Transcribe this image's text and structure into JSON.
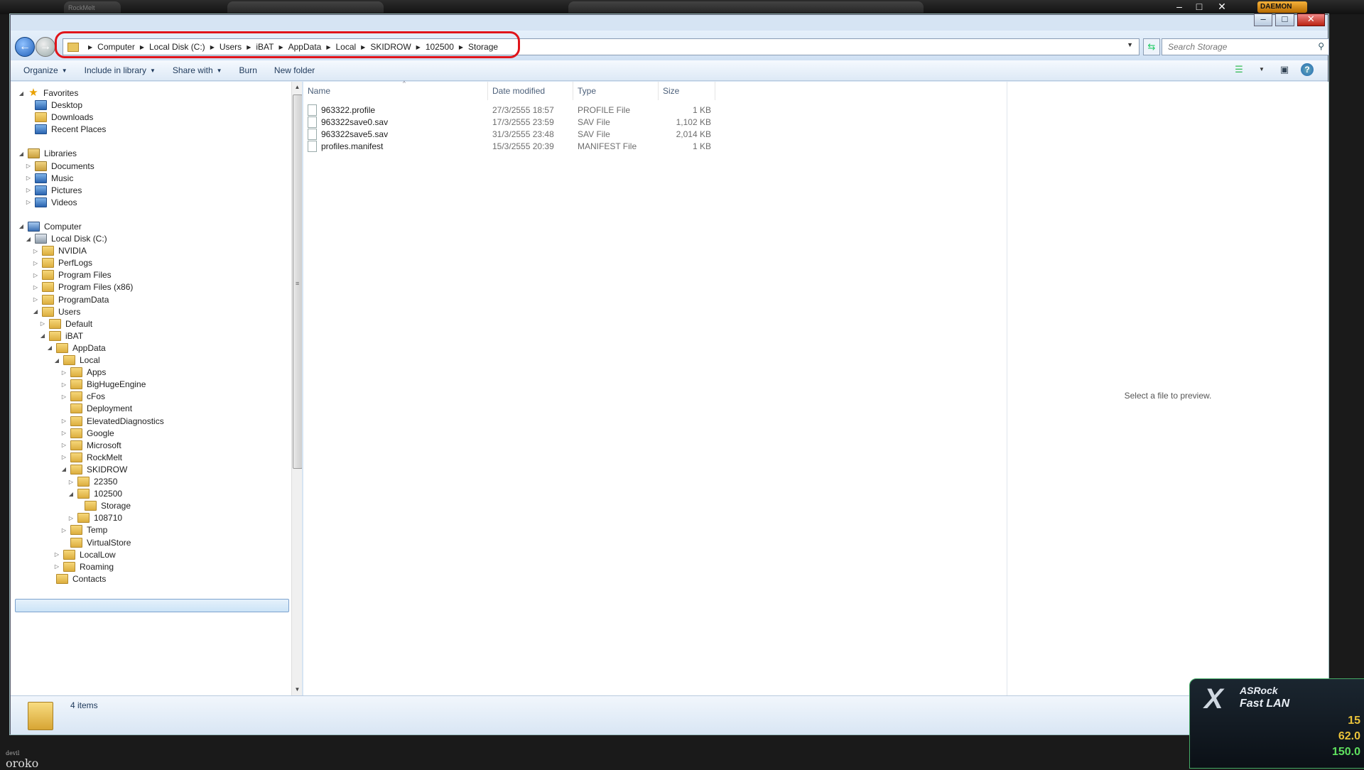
{
  "outer": {
    "taskbar_tab": "RockMelt",
    "daemon_label": "DAEMON",
    "corner_text": "oroko",
    "corner_text_small": "devil"
  },
  "window": {
    "title": "Storage",
    "breadcrumb": [
      "Computer",
      "Local Disk (C:)",
      "Users",
      "iBAT",
      "AppData",
      "Local",
      "SKIDROW",
      "102500",
      "Storage"
    ],
    "search_placeholder": "Search Storage"
  },
  "toolbar": {
    "organize": "Organize",
    "include_in_library": "Include in library",
    "share_with": "Share with",
    "burn": "Burn",
    "new_folder": "New folder"
  },
  "nav": [
    {
      "label": "Favorites",
      "level": 0,
      "icon": "star-icon",
      "expander": "expanded",
      "type": "star"
    },
    {
      "label": "Desktop",
      "level": 1,
      "icon": "desktop-icon",
      "expander": "none",
      "type": "blue"
    },
    {
      "label": "Downloads",
      "level": 1,
      "icon": "downloads-folder-icon",
      "expander": "none",
      "type": "folder"
    },
    {
      "label": "Recent Places",
      "level": 1,
      "icon": "recent-places-icon",
      "expander": "none",
      "type": "blue"
    },
    {
      "label": "",
      "level": 0,
      "icon": "",
      "expander": "none",
      "type": "spacer"
    },
    {
      "label": "Libraries",
      "level": 0,
      "icon": "libraries-icon",
      "expander": "expanded",
      "type": "lib"
    },
    {
      "label": "Documents",
      "level": 1,
      "icon": "documents-icon",
      "expander": "collapsed",
      "type": "lib"
    },
    {
      "label": "Music",
      "level": 1,
      "icon": "music-icon",
      "expander": "collapsed",
      "type": "blue"
    },
    {
      "label": "Pictures",
      "level": 1,
      "icon": "pictures-icon",
      "expander": "collapsed",
      "type": "blue"
    },
    {
      "label": "Videos",
      "level": 1,
      "icon": "videos-icon",
      "expander": "collapsed",
      "type": "blue"
    },
    {
      "label": "",
      "level": 0,
      "icon": "",
      "expander": "none",
      "type": "spacer"
    },
    {
      "label": "Computer",
      "level": 0,
      "icon": "computer-icon",
      "expander": "expanded",
      "type": "pc"
    },
    {
      "label": "Local Disk (C:)",
      "level": 1,
      "icon": "disk-icon",
      "expander": "expanded",
      "type": "disk"
    },
    {
      "label": "NVIDIA",
      "level": 2,
      "icon": "folder-icon",
      "expander": "collapsed",
      "type": "folder"
    },
    {
      "label": "PerfLogs",
      "level": 2,
      "icon": "folder-icon",
      "expander": "collapsed",
      "type": "folder"
    },
    {
      "label": "Program Files",
      "level": 2,
      "icon": "folder-icon",
      "expander": "collapsed",
      "type": "folder"
    },
    {
      "label": "Program Files (x86)",
      "level": 2,
      "icon": "folder-icon",
      "expander": "collapsed",
      "type": "folder"
    },
    {
      "label": "ProgramData",
      "level": 2,
      "icon": "folder-icon",
      "expander": "collapsed",
      "type": "folder"
    },
    {
      "label": "Users",
      "level": 2,
      "icon": "folder-icon",
      "expander": "expanded",
      "type": "folder"
    },
    {
      "label": "Default",
      "level": 3,
      "icon": "folder-icon",
      "expander": "collapsed",
      "type": "folder"
    },
    {
      "label": "iBAT",
      "level": 3,
      "icon": "user-folder-icon",
      "expander": "expanded",
      "type": "folder"
    },
    {
      "label": "AppData",
      "level": 4,
      "icon": "folder-icon",
      "expander": "expanded",
      "type": "folder"
    },
    {
      "label": "Local",
      "level": 5,
      "icon": "folder-icon",
      "expander": "expanded",
      "type": "folder"
    },
    {
      "label": "Apps",
      "level": 6,
      "icon": "folder-icon",
      "expander": "collapsed",
      "type": "folder"
    },
    {
      "label": "BigHugeEngine",
      "level": 6,
      "icon": "folder-icon",
      "expander": "collapsed",
      "type": "folder"
    },
    {
      "label": "cFos",
      "level": 6,
      "icon": "folder-icon",
      "expander": "collapsed",
      "type": "folder"
    },
    {
      "label": "Deployment",
      "level": 6,
      "icon": "folder-icon",
      "expander": "none",
      "type": "folder"
    },
    {
      "label": "ElevatedDiagnostics",
      "level": 6,
      "icon": "folder-icon",
      "expander": "collapsed",
      "type": "folder"
    },
    {
      "label": "Google",
      "level": 6,
      "icon": "folder-icon",
      "expander": "collapsed",
      "type": "folder"
    },
    {
      "label": "Microsoft",
      "level": 6,
      "icon": "folder-icon",
      "expander": "collapsed",
      "type": "folder"
    },
    {
      "label": "RockMelt",
      "level": 6,
      "icon": "folder-icon",
      "expander": "collapsed",
      "type": "folder"
    },
    {
      "label": "SKIDROW",
      "level": 6,
      "icon": "folder-icon",
      "expander": "expanded",
      "type": "folder"
    },
    {
      "label": "22350",
      "level": 7,
      "icon": "folder-icon",
      "expander": "collapsed",
      "type": "folder"
    },
    {
      "label": "102500",
      "level": 7,
      "icon": "folder-icon",
      "expander": "expanded",
      "type": "folder"
    },
    {
      "label": "Storage",
      "level": 8,
      "icon": "folder-icon",
      "expander": "none",
      "type": "folder",
      "selected": true
    },
    {
      "label": "108710",
      "level": 7,
      "icon": "folder-icon",
      "expander": "collapsed",
      "type": "folder"
    },
    {
      "label": "Temp",
      "level": 6,
      "icon": "folder-icon",
      "expander": "collapsed",
      "type": "folder"
    },
    {
      "label": "VirtualStore",
      "level": 6,
      "icon": "folder-icon",
      "expander": "none",
      "type": "folder"
    },
    {
      "label": "LocalLow",
      "level": 5,
      "icon": "folder-icon",
      "expander": "collapsed",
      "type": "folder"
    },
    {
      "label": "Roaming",
      "level": 5,
      "icon": "folder-icon",
      "expander": "collapsed",
      "type": "folder"
    },
    {
      "label": "Contacts",
      "level": 4,
      "icon": "folder-icon",
      "expander": "none",
      "type": "folder"
    }
  ],
  "columns": {
    "name": "Name",
    "date": "Date modified",
    "type": "Type",
    "size": "Size"
  },
  "files": [
    {
      "name": "963322.profile",
      "date": "27/3/2555 18:57",
      "type": "PROFILE File",
      "size": "1 KB"
    },
    {
      "name": "963322save0.sav",
      "date": "17/3/2555 23:59",
      "type": "SAV File",
      "size": "1,102 KB"
    },
    {
      "name": "963322save5.sav",
      "date": "31/3/2555 23:48",
      "type": "SAV File",
      "size": "2,014 KB"
    },
    {
      "name": "profiles.manifest",
      "date": "15/3/2555 20:39",
      "type": "MANIFEST File",
      "size": "1 KB"
    }
  ],
  "preview_message": "Select a file to preview.",
  "status": {
    "item_count": "4 items"
  },
  "asrock": {
    "brand": "ASRock",
    "product": "Fast LAN",
    "big_letter": "X",
    "readouts": [
      "15",
      "62.0",
      "150.0"
    ]
  }
}
